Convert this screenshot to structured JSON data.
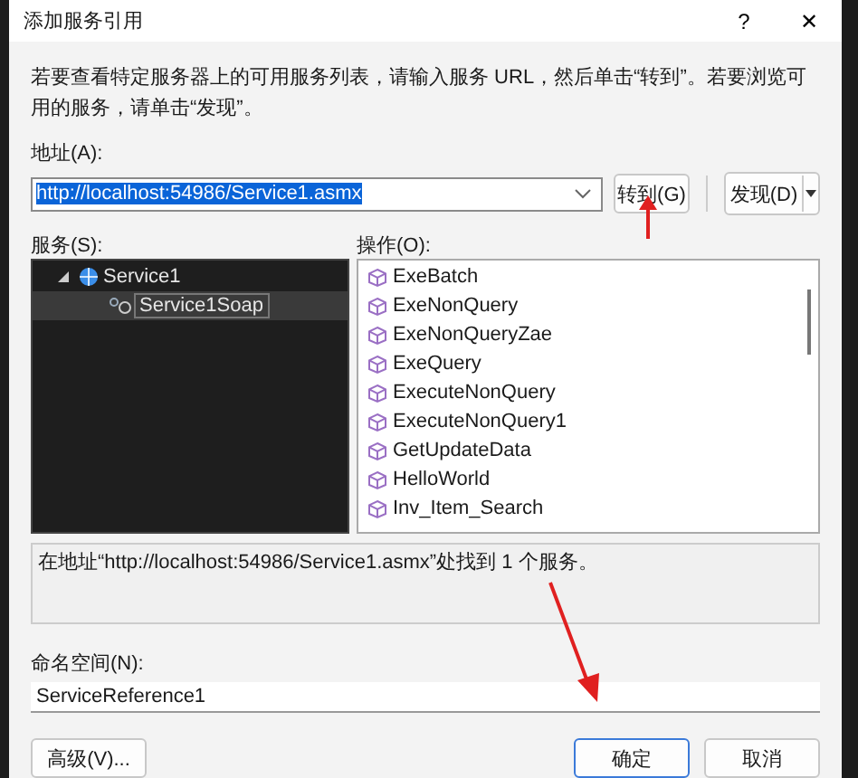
{
  "window": {
    "title": "添加服务引用",
    "help": "?",
    "close": "✕"
  },
  "instructions": "若要查看特定服务器上的可用服务列表，请输入服务 URL，然后单击“转到”。若要浏览可用的服务，请单击“发现”。",
  "address": {
    "label": "地址(A):",
    "value": "http://localhost:54986/Service1.asmx",
    "value_selected": true
  },
  "go_button": "转到(G)",
  "discover_button": "发现(D)",
  "services": {
    "label": "服务(S):",
    "tree": [
      {
        "label": "Service1",
        "expanded": true,
        "selected": false,
        "children": [
          {
            "label": "Service1Soap",
            "selected": true
          }
        ]
      }
    ]
  },
  "operations": {
    "label": "操作(O):",
    "items": [
      "ExeBatch",
      "ExeNonQuery",
      "ExeNonQueryZae",
      "ExeQuery",
      "ExecuteNonQuery",
      "ExecuteNonQuery1",
      "GetUpdateData",
      "HelloWorld",
      "Inv_Item_Search"
    ]
  },
  "status": "在地址“http://localhost:54986/Service1.asmx”处找到 1 个服务。",
  "namespace": {
    "label": "命名空间(N):",
    "value": "ServiceReference1"
  },
  "buttons": [
    {
      "label": "高级(V)...",
      "default": false
    },
    {
      "label": "确定",
      "default": true
    },
    {
      "label": "取消",
      "default": false
    }
  ]
}
